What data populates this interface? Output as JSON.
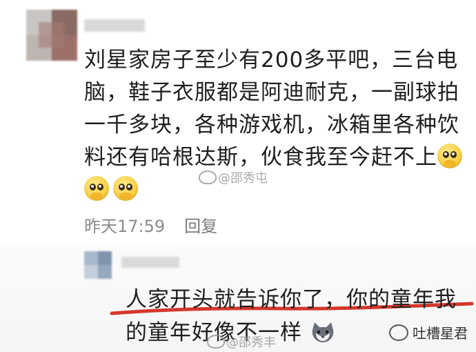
{
  "comment": {
    "text": "刘星家房子至少有200多平吧，三台电脑，鞋子衣服都是阿迪耐克，一副球拍一千多块，各种游戏机，冰箱里各种饮料还有哈根达斯，伙食我至今赶不上",
    "emoji": "crying-pleading-emoji",
    "time": "昨天17:59",
    "reply_label": "回复"
  },
  "reply": {
    "line1": "人家开头就告诉你了，你的童年我",
    "line2": "的童年好像不一样",
    "emoji": "cat-emoji",
    "underline_color": "#d4372c"
  },
  "watermarks": {
    "center": "@邵秀屯",
    "bottom": "@邵秀丰"
  },
  "brand": {
    "name": "吐槽星君"
  },
  "colors": {
    "text": "#1e1e1e",
    "meta": "#8a8a8a",
    "accent_red": "#d4372c"
  }
}
